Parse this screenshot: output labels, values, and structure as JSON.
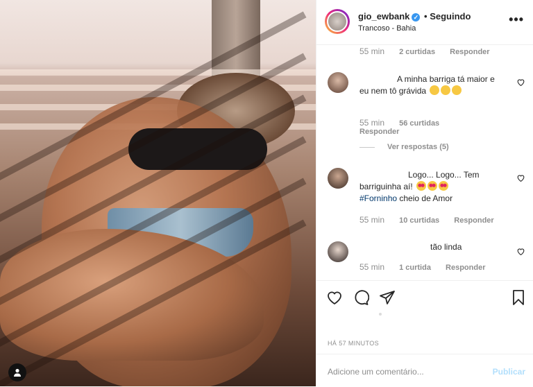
{
  "post": {
    "username": "gio_ewbank",
    "verified_icon": "verified-badge-icon",
    "follow_state": "• Seguindo",
    "location": "Trancoso - Bahia",
    "more_icon": "more-options-icon"
  },
  "top_meta": {
    "time": "55 min",
    "likes": "2 curtidas",
    "reply": "Responder"
  },
  "comments": [
    {
      "text": "A minha barriga tá maior e eu nem tô grávida",
      "time": "55 min",
      "likes": "56 curtidas",
      "reply": "Responder",
      "view_replies": "Ver respostas (5)"
    },
    {
      "text": "Logo... Logo... Tem barriguinha aí!",
      "hashtag": "#Forninho",
      "text_after": " cheio de Amor",
      "time": "55 min",
      "likes": "10 curtidas",
      "reply": "Responder"
    },
    {
      "text": "tão linda",
      "time": "55 min",
      "likes": "1 curtida",
      "reply": "Responder"
    }
  ],
  "actions": {
    "like_icon": "heart-icon",
    "comment_icon": "comment-icon",
    "share_icon": "send-icon",
    "save_icon": "bookmark-icon"
  },
  "posted_ago": "HÁ 57 MINUTOS",
  "comment_box": {
    "placeholder": "Adicione um comentário...",
    "publish": "Publicar"
  },
  "colors": {
    "verified": "#3897f0",
    "publish_disabled": "#b2dffc",
    "hashtag": "#00376b"
  }
}
